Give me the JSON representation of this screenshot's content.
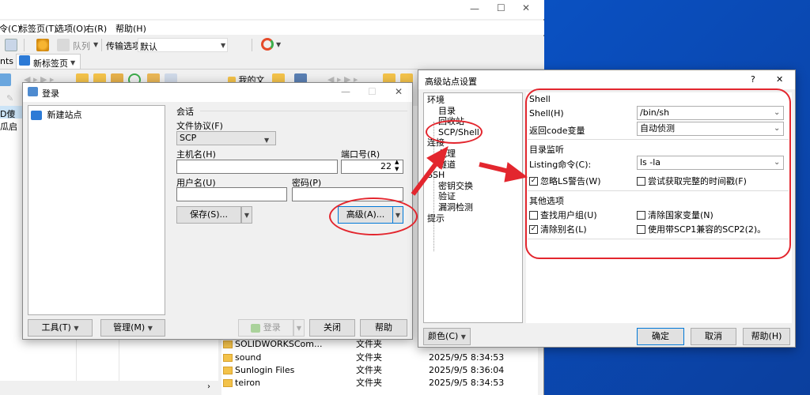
{
  "winscp": {
    "menu": [
      "令(C)",
      "标签页(T)",
      "选项(O)",
      "右(R)",
      "帮助(H)"
    ],
    "toolbar": {
      "queue_label": "队列",
      "transfer_label": "传输选项",
      "transfer_value": "默认"
    },
    "tabs": {
      "left_partial": "nts",
      "new_tab": "新标签页"
    },
    "right_panel_path": "我的文",
    "left_panel_partial": "D傻瓜启",
    "files": [
      {
        "name": "SOLIDWORKSCom...",
        "type": "文件夹",
        "date": ""
      },
      {
        "name": "sound",
        "type": "文件夹",
        "date": "2025/9/5  8:34:53"
      },
      {
        "name": "Sunlogin Files",
        "type": "文件夹",
        "date": "2025/9/5  8:36:04"
      },
      {
        "name": "teiron",
        "type": "文件夹",
        "date": "2025/9/5  8:34:53"
      }
    ]
  },
  "login": {
    "title": "登录",
    "site_list_item": "新建站点",
    "session_group": "会话",
    "protocol_label": "文件协议(F)",
    "protocol_value": "SCP",
    "host_label": "主机名(H)",
    "host_value": "",
    "port_label": "端口号(R)",
    "port_value": "22",
    "user_label": "用户名(U)",
    "user_value": "",
    "password_label": "密码(P)",
    "password_value": "",
    "save_button": "保存(S)...",
    "advanced_button": "高级(A)...",
    "tools_button": "工具(T)",
    "manage_button": "管理(M)",
    "login_button": "登录",
    "close_button": "关闭",
    "help_button": "帮助"
  },
  "advanced": {
    "title": "高级站点设置",
    "help_glyph": "?",
    "close_glyph": "✕",
    "tree": [
      {
        "label": "环境",
        "level": 0
      },
      {
        "label": "目录",
        "level": 1
      },
      {
        "label": "回收站",
        "level": 1
      },
      {
        "label": "SCP/Shell",
        "level": 1
      },
      {
        "label": "连接",
        "level": 0
      },
      {
        "label": "代理",
        "level": 1
      },
      {
        "label": "隧道",
        "level": 1
      },
      {
        "label": "SSH",
        "level": 0
      },
      {
        "label": "密钥交换",
        "level": 1
      },
      {
        "label": "验证",
        "level": 1
      },
      {
        "label": "漏洞检测",
        "level": 1
      },
      {
        "label": "提示",
        "level": 0
      }
    ],
    "shell_group": "Shell",
    "shell_label": "Shell(H)",
    "shell_value": "/bin/sh",
    "retcode_label": "返回code变量",
    "retcode_value": "自动侦测",
    "dirlist_group": "目录监听",
    "listing_label": "Listing命令(C):",
    "listing_value": "ls -la",
    "ignore_ls_label": "忽略LS警告(W)",
    "ignore_ls_checked": true,
    "full_timestamp_label": "尝试获取完整的时间戳(F)",
    "full_timestamp_checked": false,
    "other_group": "其他选项",
    "lookup_groups_label": "查找用户组(U)",
    "lookup_groups_checked": false,
    "clear_national_label": "清除国家变量(N)",
    "clear_national_checked": false,
    "clear_alias_label": "清除别名(L)",
    "clear_alias_checked": true,
    "scp1_label": "使用带SCP1兼容的SCP2(2)。",
    "scp1_checked": false,
    "color_button": "颜色(C)",
    "ok_button": "确定",
    "cancel_button": "取消",
    "help_button": "帮助(H)"
  },
  "annotation_color": "#e3262e"
}
